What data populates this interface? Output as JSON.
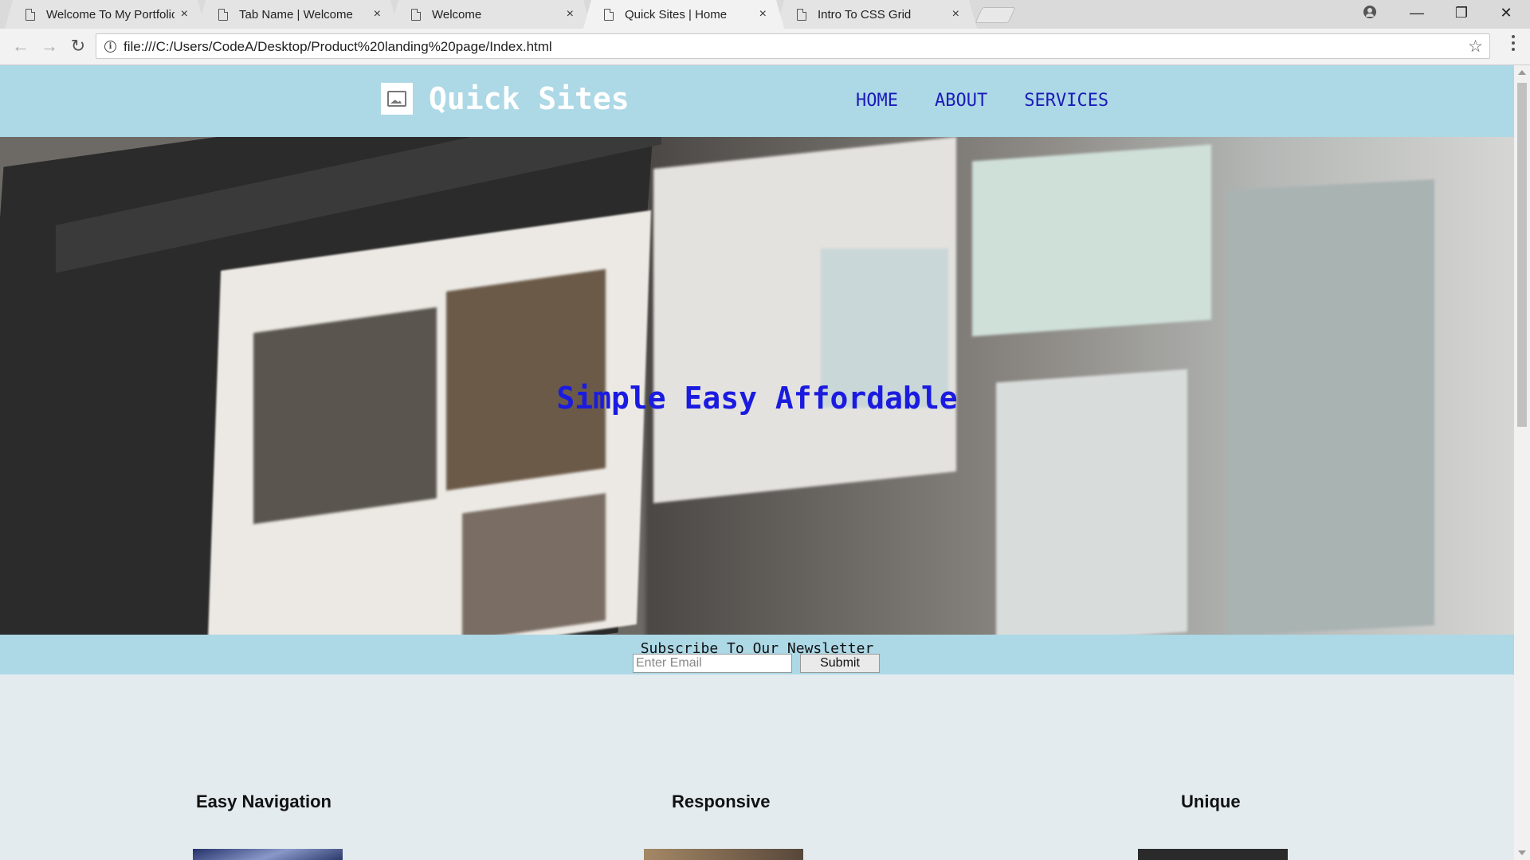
{
  "browser": {
    "tabs": [
      {
        "title": "Welcome To My Portfolio",
        "active": false
      },
      {
        "title": "Tab Name | Welcome",
        "active": false
      },
      {
        "title": "Welcome",
        "active": false
      },
      {
        "title": "Quick Sites | Home",
        "active": true
      },
      {
        "title": "Intro To CSS Grid",
        "active": false
      }
    ],
    "tab_close_glyph": "×",
    "url": "file:///C:/Users/CodeA/Desktop/Product%20landing%20page/Index.html",
    "nav": {
      "back": "←",
      "forward": "→",
      "reload": "↻"
    },
    "info_glyph": "i",
    "star_glyph": "☆",
    "window_controls": {
      "minimize": "—",
      "maximize": "❐",
      "close": "✕"
    }
  },
  "site": {
    "brand": "Quick Sites",
    "nav_links": [
      "HOME",
      "ABOUT",
      "SERVICES"
    ],
    "hero_title": "Simple Easy Affordable",
    "newsletter": {
      "title": "Subscribe To Our Newsletter",
      "email_placeholder": "Enter Email",
      "submit_label": "Submit"
    },
    "features": [
      "Easy Navigation",
      "Responsive",
      "Unique"
    ]
  },
  "colors": {
    "header_bg": "#add8e6",
    "nav_link": "#1b1bb8",
    "hero_title": "#1b1be0",
    "page_bg": "#e3ebee"
  }
}
